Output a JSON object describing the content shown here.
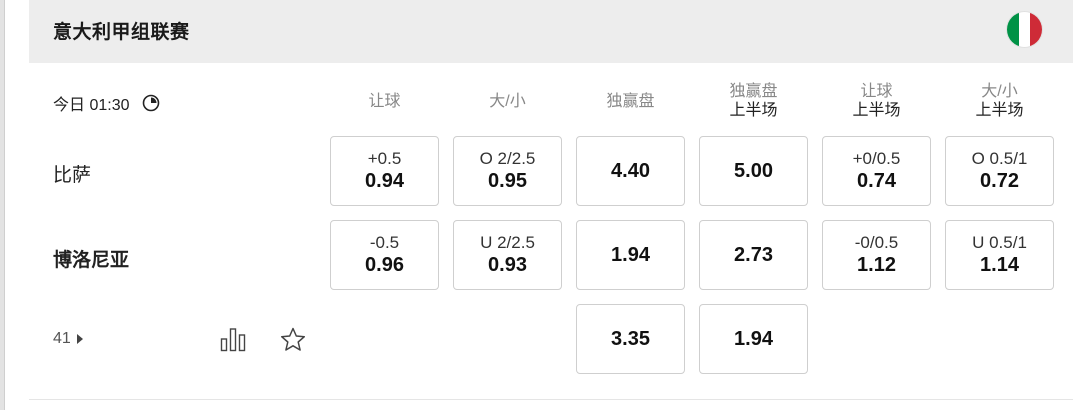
{
  "league": {
    "name": "意大利甲组联赛",
    "flag_colors": [
      "#009246",
      "#ffffff",
      "#ce2b37"
    ]
  },
  "match": {
    "time": "今日 01:30",
    "more_count": "41",
    "teams": {
      "home": "比萨",
      "away": "博洛尼亚"
    }
  },
  "columns": [
    {
      "line1": "让球",
      "line2": ""
    },
    {
      "line1": "大/小",
      "line2": ""
    },
    {
      "line1": "独赢盘",
      "line2": ""
    },
    {
      "line1": "独赢盘",
      "line2": "上半场"
    },
    {
      "line1": "让球",
      "line2": "上半场"
    },
    {
      "line1": "大/小",
      "line2": "上半场"
    }
  ],
  "odds": {
    "home": [
      {
        "line": "+0.5",
        "value": "0.94"
      },
      {
        "line": "O 2/2.5",
        "value": "0.95"
      },
      {
        "line": "",
        "value": "4.40"
      },
      {
        "line": "",
        "value": "5.00"
      },
      {
        "line": "+0/0.5",
        "value": "0.74"
      },
      {
        "line": "O 0.5/1",
        "value": "0.72"
      }
    ],
    "away": [
      {
        "line": "-0.5",
        "value": "0.96"
      },
      {
        "line": "U 2/2.5",
        "value": "0.93"
      },
      {
        "line": "",
        "value": "1.94"
      },
      {
        "line": "",
        "value": "2.73"
      },
      {
        "line": "-0/0.5",
        "value": "1.12"
      },
      {
        "line": "U 0.5/1",
        "value": "1.14"
      }
    ],
    "draw": [
      {
        "value": "3.35"
      },
      {
        "value": "1.94"
      }
    ]
  },
  "icons": {
    "clock": "clock-icon",
    "stats": "bar-chart-icon",
    "favorite": "star-icon",
    "expand": "triangle-right-icon"
  }
}
